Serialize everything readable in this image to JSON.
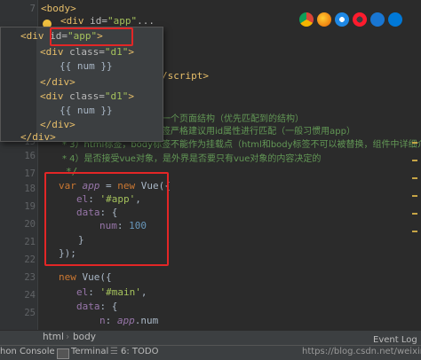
{
  "gutter": {
    "line_numbers": [
      "7",
      "8",
      "9",
      "10",
      "11",
      "12",
      "13",
      "14",
      "15",
      "16",
      "17",
      "18",
      "19",
      "20",
      "21",
      "22",
      "23",
      "24",
      "25",
      "26",
      "27",
      "28",
      "29"
    ]
  },
  "code": {
    "line7": {
      "open": "<",
      "tag": "body",
      "close": ">"
    },
    "line8": {
      "tag_open": "<div ",
      "attr": "id=",
      "val": "\"app\"",
      "rest": "..."
    },
    "line_script_close": "/script>",
    "line_comment1": "一个页面结构（优先匹配到的结构）",
    "line_comment2": "签严格建议用id属性进行匹配（一般习惯用app）",
    "line_comment3": "* 3）html标签，body标签不能作为挂载点（html和body标签不可以被替换，组件中详细介绍",
    "line_comment4": "* 4）是否接受vue对象，是外界是否要只有vue对象的内容决定的",
    "line_comment_end": "*/",
    "line_var": {
      "kw": "var",
      "name": "app",
      "eq": " = ",
      "new": "new",
      "ctor": " Vue({"
    },
    "line_el": {
      "prop": "el",
      "colon": ": ",
      "val": "'#app'",
      "comma": ","
    },
    "line_data": {
      "prop": "data",
      "rest": ": {"
    },
    "line_num": {
      "prop": "num",
      "colon": ": ",
      "val": "100"
    },
    "line_close_inner": "}",
    "line_close_outer": "});",
    "line_new": {
      "new": "new",
      "ctor": " Vue({"
    },
    "line_el2": {
      "prop": "el",
      "colon": ": ",
      "val": "'#main'",
      "comma": ","
    },
    "line_data2": {
      "prop": "data",
      "rest": ": {"
    },
    "line_n": {
      "prop": "n",
      "colon": ": ",
      "obj": "app",
      "dot": ".num"
    }
  },
  "popup": {
    "line8": {
      "lt": "<",
      "tag": "div ",
      "attr": "id=",
      "val": "\"app\"",
      "gt": ">"
    },
    "line9": {
      "lt": "<",
      "tag": "div ",
      "attr": "class=",
      "val": "\"d1\"",
      "gt": ">"
    },
    "line10": "{{ num }}",
    "line11": {
      "lt": "</",
      "tag": "div",
      "gt": ">"
    },
    "line12": {
      "lt": "<",
      "tag": "div ",
      "attr": "class=",
      "val": "\"d1\"",
      "gt": ">"
    },
    "line13": "{{ num }}",
    "line14": {
      "lt": "</",
      "tag": "div",
      "gt": ">"
    },
    "line15": {
      "lt": "</",
      "tag": "div",
      "gt": ">"
    }
  },
  "breadcrumb": {
    "item1": "html",
    "item2": "body"
  },
  "statusbar": {
    "python_console": "hon Console",
    "terminal": "Terminal",
    "todo": "6: TODO",
    "url": "https://blog.csdn.net/weixin",
    "event_log": "Event Log"
  },
  "colors": {
    "highlight_box": "#e32626"
  }
}
